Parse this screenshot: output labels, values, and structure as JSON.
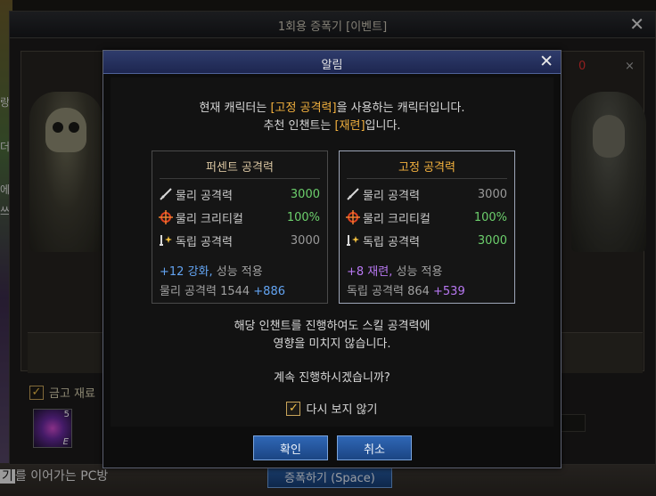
{
  "background": {
    "left_texts": [
      "랑",
      "더 ",
      "에 ",
      "쓰"
    ],
    "bottom_text_key": "기",
    "bottom_text": "를 이어가는 PC방",
    "bottom_text2": "",
    "bottom_text3": ""
  },
  "outer_window": {
    "title": "1회용 증폭기 [이벤트]",
    "close": "✕",
    "side_red": "0",
    "side_x": "×",
    "checkbox_label": "금고 재료 ",
    "item_badge": "5",
    "item_badge2": "E",
    "amplify_button": "증폭하기 (Space)"
  },
  "dialog": {
    "title": "알림",
    "close": "✕",
    "message_line1_pre": "현재 캐릭터는 ",
    "message_line1_hl": "[고정 공격력]",
    "message_line1_post": "을 사용하는 캐릭터입니다.",
    "message_line2_pre": "추천 인챈트는 ",
    "message_line2_hl": "[재련]",
    "message_line2_post": "입니다.",
    "left_box": {
      "header": "퍼센트 공격력",
      "rows": [
        {
          "label": "물리 공격력",
          "value": "3000"
        },
        {
          "label": "물리 크리티컬",
          "value": "100%"
        },
        {
          "label": "독립 공격력",
          "value": "3000"
        }
      ],
      "foot1_hl": "+12 강화,",
      "foot1_rest": " 성능 적용",
      "foot2_label": "물리 공격력 1544 ",
      "foot2_bonus": "+886"
    },
    "right_box": {
      "header": "고정 공격력",
      "rows": [
        {
          "label": "물리 공격력",
          "value": "3000"
        },
        {
          "label": "물리 크리티컬",
          "value": "100%"
        },
        {
          "label": "독립 공격력",
          "value": "3000"
        }
      ],
      "foot1_hl": "+8 재련,",
      "foot1_rest": " 성능 적용",
      "foot2_label": "독립 공격력 864 ",
      "foot2_bonus": "+539"
    },
    "notice_line1": "해당 인챈트를 진행하여도 스킬 공격력에",
    "notice_line2": "영향을 미치지 않습니다.",
    "question": "계속 진행하시겠습니까?",
    "dont_show_label": "다시 보지 않기",
    "confirm_button": "확인",
    "cancel_button": "취소"
  },
  "colors": {
    "highlight": "#f3b13e",
    "green": "#6ccf6c",
    "blue": "#63a4f2",
    "purple": "#b878f2"
  },
  "icons": [
    "sword-icon",
    "crosshair-icon",
    "spark-sword-icon",
    "checkmark-icon",
    "close-icon"
  ]
}
